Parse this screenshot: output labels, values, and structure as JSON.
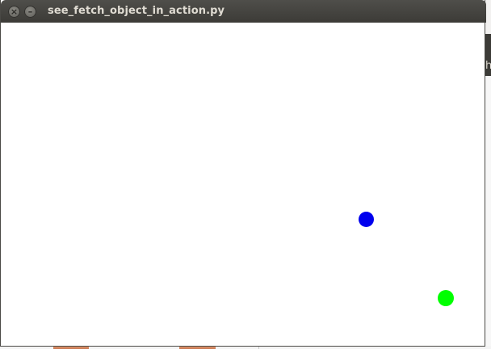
{
  "window": {
    "title": "see_fetch_object_in_action.py",
    "controls": {
      "close_icon": "close-icon",
      "minimize_icon": "minimize-icon",
      "close_glyph": "×",
      "minimize_glyph": "–"
    }
  },
  "canvas": {
    "background_color": "#ffffff",
    "objects": [
      {
        "name": "blue-ball",
        "color": "#0000ee"
      },
      {
        "name": "green-ball",
        "color": "#00ff00"
      }
    ]
  },
  "background": {
    "panel_text": "h"
  }
}
